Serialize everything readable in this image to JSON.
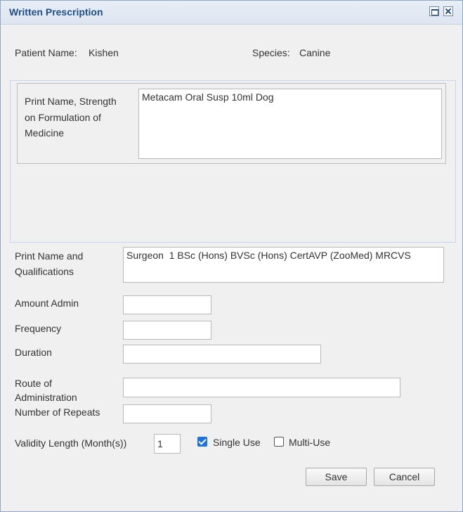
{
  "dialog": {
    "title": "Written Prescription"
  },
  "patient": {
    "name_label": "Patient Name:",
    "name": "Kishen",
    "species_label": "Species:",
    "species": "Canine"
  },
  "medicine": {
    "label": "Print Name, Strength on Formulation of Medicine",
    "value": "Metacam Oral Susp 10ml Dog"
  },
  "qualifications": {
    "label": "Print Name and Qualifications",
    "value": "Surgeon  1 BSc (Hons) BVSc (Hons) CertAVP (ZooMed) MRCVS"
  },
  "amount_admin": {
    "label": "Amount Admin",
    "value": ""
  },
  "frequency": {
    "label": "Frequency",
    "value": ""
  },
  "duration": {
    "label": "Duration",
    "value": ""
  },
  "route": {
    "label": "Route of Administration",
    "value": ""
  },
  "repeats": {
    "label": "Number of Repeats",
    "value": ""
  },
  "validity": {
    "label": "Validity Length (Month(s))",
    "value": "1"
  },
  "usage": {
    "single_label": "Single Use",
    "single_checked": true,
    "multi_label": "Multi-Use",
    "multi_checked": false
  },
  "actions": {
    "save": "Save",
    "cancel": "Cancel"
  }
}
